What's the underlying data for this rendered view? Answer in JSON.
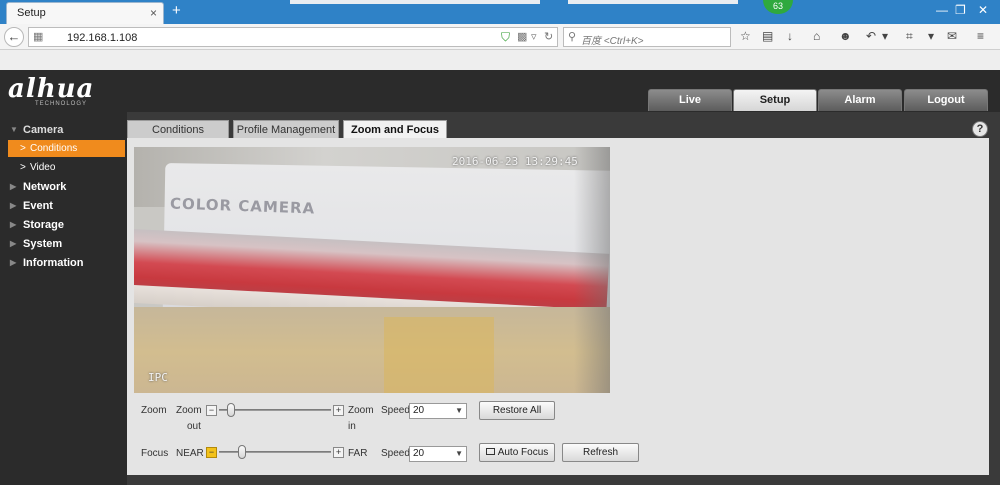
{
  "browser": {
    "tab_title": "Setup",
    "tab_close": "×",
    "new_tab": "+",
    "badge": "63",
    "url": "192.168.1.108",
    "search_placeholder": "百度 <Ctrl+K>"
  },
  "app": {
    "logo": "alhua",
    "logo_sub": "TECHNOLOGY",
    "top_tabs": [
      {
        "label": "Live"
      },
      {
        "label": "Setup"
      },
      {
        "label": "Alarm"
      },
      {
        "label": "Logout"
      }
    ]
  },
  "sidebar": {
    "items": [
      {
        "label": "Camera"
      },
      {
        "label": "Network"
      },
      {
        "label": "Event"
      },
      {
        "label": "Storage"
      },
      {
        "label": "System"
      },
      {
        "label": "Information"
      }
    ],
    "sub_items": [
      {
        "label": "Conditions"
      },
      {
        "label": "Video"
      }
    ]
  },
  "subtabs": [
    {
      "label": "Conditions"
    },
    {
      "label": "Profile Management"
    },
    {
      "label": "Zoom and Focus"
    }
  ],
  "help": "?",
  "video": {
    "brand_text": "COLOR CAMERA",
    "timestamp": "2016-06-23 13:29:45",
    "channel_label": "IPC"
  },
  "zoom": {
    "label": "Zoom",
    "out_label_1": "Zoom",
    "out_label_2": "out",
    "in_label_1": "Zoom",
    "in_label_2": "in",
    "minus": "−",
    "plus": "+",
    "level": 0.08,
    "speed_label": "Speed",
    "speed_value": "20",
    "restore_label": "Restore All"
  },
  "focus": {
    "label": "Focus",
    "near_label": "NEAR",
    "far_label": "FAR",
    "minus": "−",
    "plus": "+",
    "level": 0.18,
    "speed_label": "Speed",
    "speed_value": "20",
    "auto_focus_label": "Auto Focus",
    "refresh_label": "Refresh"
  }
}
